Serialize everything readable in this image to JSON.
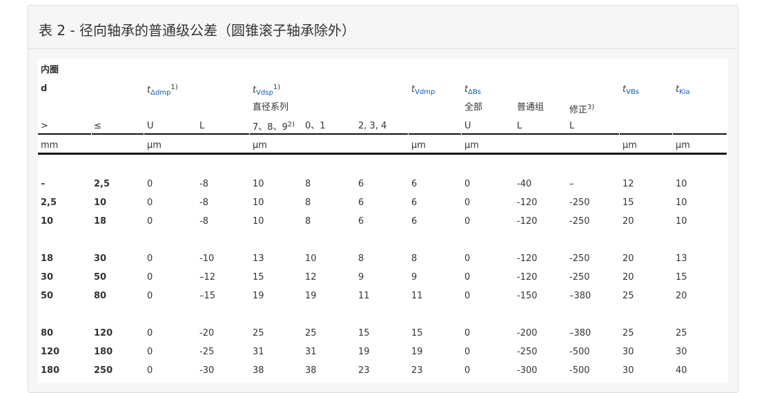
{
  "title": "表 2 - 径向轴承的普通级公差（圆锥滚子轴承除外）",
  "section": "内圈",
  "header": {
    "d": "d",
    "t_dmp": {
      "main": "t",
      "sub": "Δdmp",
      "sup": "1)"
    },
    "t_vdsp": {
      "main": "t",
      "sub": "Vdsp",
      "sup": "1)"
    },
    "t_vdmp": {
      "main": "t",
      "sub": "Vdmp"
    },
    "t_bs": {
      "main": "t",
      "sub": "ΔBs"
    },
    "t_vbs": {
      "main": "t",
      "sub": "VBs"
    },
    "t_kia": {
      "main": "t",
      "sub": "Kia"
    },
    "diameter_series": "直径系列",
    "all": "全部",
    "normal_group": "普通组",
    "modified": "修正",
    "modified_sup": "3)",
    "gt": ">",
    "le": "≤",
    "u1": "U",
    "l1": "L",
    "series_789": "7、8、9",
    "series_789_sup": "2)",
    "series_01": "0、1",
    "series_234": "2, 3, 4",
    "u2": "U",
    "l2": "L",
    "l3": "L"
  },
  "units": {
    "mm": "mm",
    "um1": "µm",
    "um2": "µm",
    "um3": "µm",
    "um4": "µm",
    "um5": "µm",
    "um6": "µm"
  },
  "rows": [
    [
      "–",
      "2,5",
      "0",
      "-8",
      "10",
      "8",
      "6",
      "6",
      "0",
      "-40",
      "–",
      "12",
      "10"
    ],
    [
      "2,5",
      "10",
      "0",
      "-8",
      "10",
      "8",
      "6",
      "6",
      "0",
      "-120",
      "-250",
      "15",
      "10"
    ],
    [
      "10",
      "18",
      "0",
      "-8",
      "10",
      "8",
      "6",
      "6",
      "0",
      "-120",
      "-250",
      "20",
      "10"
    ],
    [
      "18",
      "30",
      "0",
      "-10",
      "13",
      "10",
      "8",
      "8",
      "0",
      "-120",
      "-250",
      "20",
      "13"
    ],
    [
      "30",
      "50",
      "0",
      "–12",
      "15",
      "12",
      "9",
      "9",
      "0",
      "-120",
      "-250",
      "20",
      "15"
    ],
    [
      "50",
      "80",
      "0",
      "–15",
      "19",
      "19",
      "11",
      "11",
      "0",
      "-150",
      "–380",
      "25",
      "20"
    ],
    [
      "80",
      "120",
      "0",
      "-20",
      "25",
      "25",
      "15",
      "15",
      "0",
      "-200",
      "–380",
      "25",
      "25"
    ],
    [
      "120",
      "180",
      "0",
      "-25",
      "31",
      "31",
      "19",
      "19",
      "0",
      "-250",
      "-500",
      "30",
      "30"
    ],
    [
      "180",
      "250",
      "0",
      "-30",
      "38",
      "38",
      "23",
      "23",
      "0",
      "-300",
      "-500",
      "30",
      "40"
    ]
  ]
}
